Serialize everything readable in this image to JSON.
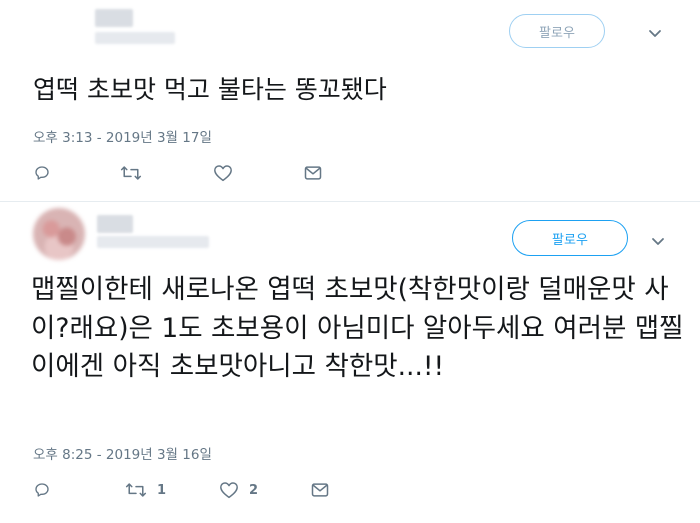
{
  "tweets": [
    {
      "follow_label": "팔로우",
      "text": "엽떡 초보맛 먹고 불타는 똥꼬됐다",
      "timestamp": "오후 3:13 - 2019년 3월 17일",
      "reply_count": "",
      "retweet_count": "",
      "like_count": ""
    },
    {
      "follow_label": "팔로우",
      "text": "맵찔이한테 새로나온 엽떡 초보맛(착한맛이랑 덜매운맛 사이?래요)은 1도 초보용이 아님미다 알아두세요 여러분 맵찔이에겐 아직 초보맛아니고 착한맛...!!",
      "timestamp": "오후 8:25 - 2019년 3월 16일",
      "reply_count": "",
      "retweet_count": "1",
      "like_count": "2"
    }
  ],
  "icons": {
    "reply": "reply-icon",
    "retweet": "retweet-icon",
    "like": "like-icon",
    "message": "message-icon",
    "more": "chevron-down-icon"
  },
  "colors": {
    "accent": "#1da1f2",
    "text": "#14171a",
    "secondary": "#657786"
  }
}
